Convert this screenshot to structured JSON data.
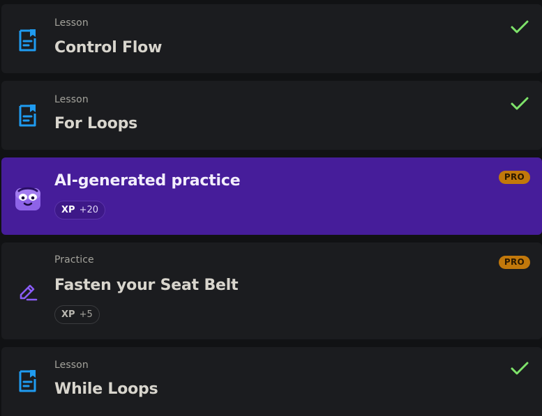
{
  "colors": {
    "page_background": "#111214",
    "card_background": "#1b1c1f",
    "active_card_background": "#461d9a",
    "check_green": "#7ee36a",
    "lesson_icon_blue": "#1f9bf0",
    "practice_icon_purple": "#8a5cf6",
    "pro_badge": "#c2780b"
  },
  "items": [
    {
      "kind": "Lesson",
      "title": "Control Flow",
      "icon": "lesson-document-icon",
      "status": "completed",
      "status_icon": "check-icon"
    },
    {
      "kind": "Lesson",
      "title": "For Loops",
      "icon": "lesson-document-icon",
      "status": "completed",
      "status_icon": "check-icon"
    },
    {
      "kind": "",
      "title": "AI-generated practice",
      "icon": "ai-robot-mascot-icon",
      "badge": "PRO",
      "xp_label": "XP",
      "xp_value": "+20",
      "active": true
    },
    {
      "kind": "Practice",
      "title": "Fasten your Seat Belt",
      "icon": "pencil-practice-icon",
      "badge": "PRO",
      "xp_label": "XP",
      "xp_value": "+5"
    },
    {
      "kind": "Lesson",
      "title": "While Loops",
      "icon": "lesson-document-icon",
      "status": "completed",
      "status_icon": "check-icon"
    }
  ]
}
